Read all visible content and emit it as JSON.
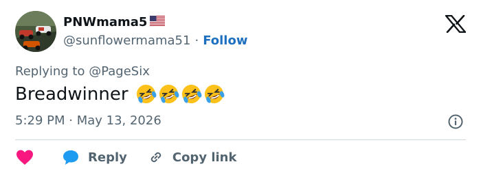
{
  "author": {
    "display_name": "PNWmama5",
    "handle": "@sunflowermama51",
    "separator": "·",
    "follow_label": "Follow",
    "flag_icon": "us-flag-icon",
    "avatar_icon": "race-car-avatar"
  },
  "reply_context": {
    "prefix": "Replying to",
    "handle": "@PageSix"
  },
  "tweet": {
    "text": "Breadwinner",
    "emojis": [
      "🤣",
      "🤣",
      "🤣",
      "🤣"
    ]
  },
  "timestamp": "5:29 PM · May 13, 2026",
  "actions": {
    "like_icon": "heart-icon",
    "reply_label": "Reply",
    "copy_label": "Copy link"
  },
  "colors": {
    "text": "#0f1419",
    "muted": "#536471",
    "link": "#1d6fbf",
    "like": "#f91880",
    "reply": "#1d9bf0",
    "divider": "#cfd9de"
  }
}
